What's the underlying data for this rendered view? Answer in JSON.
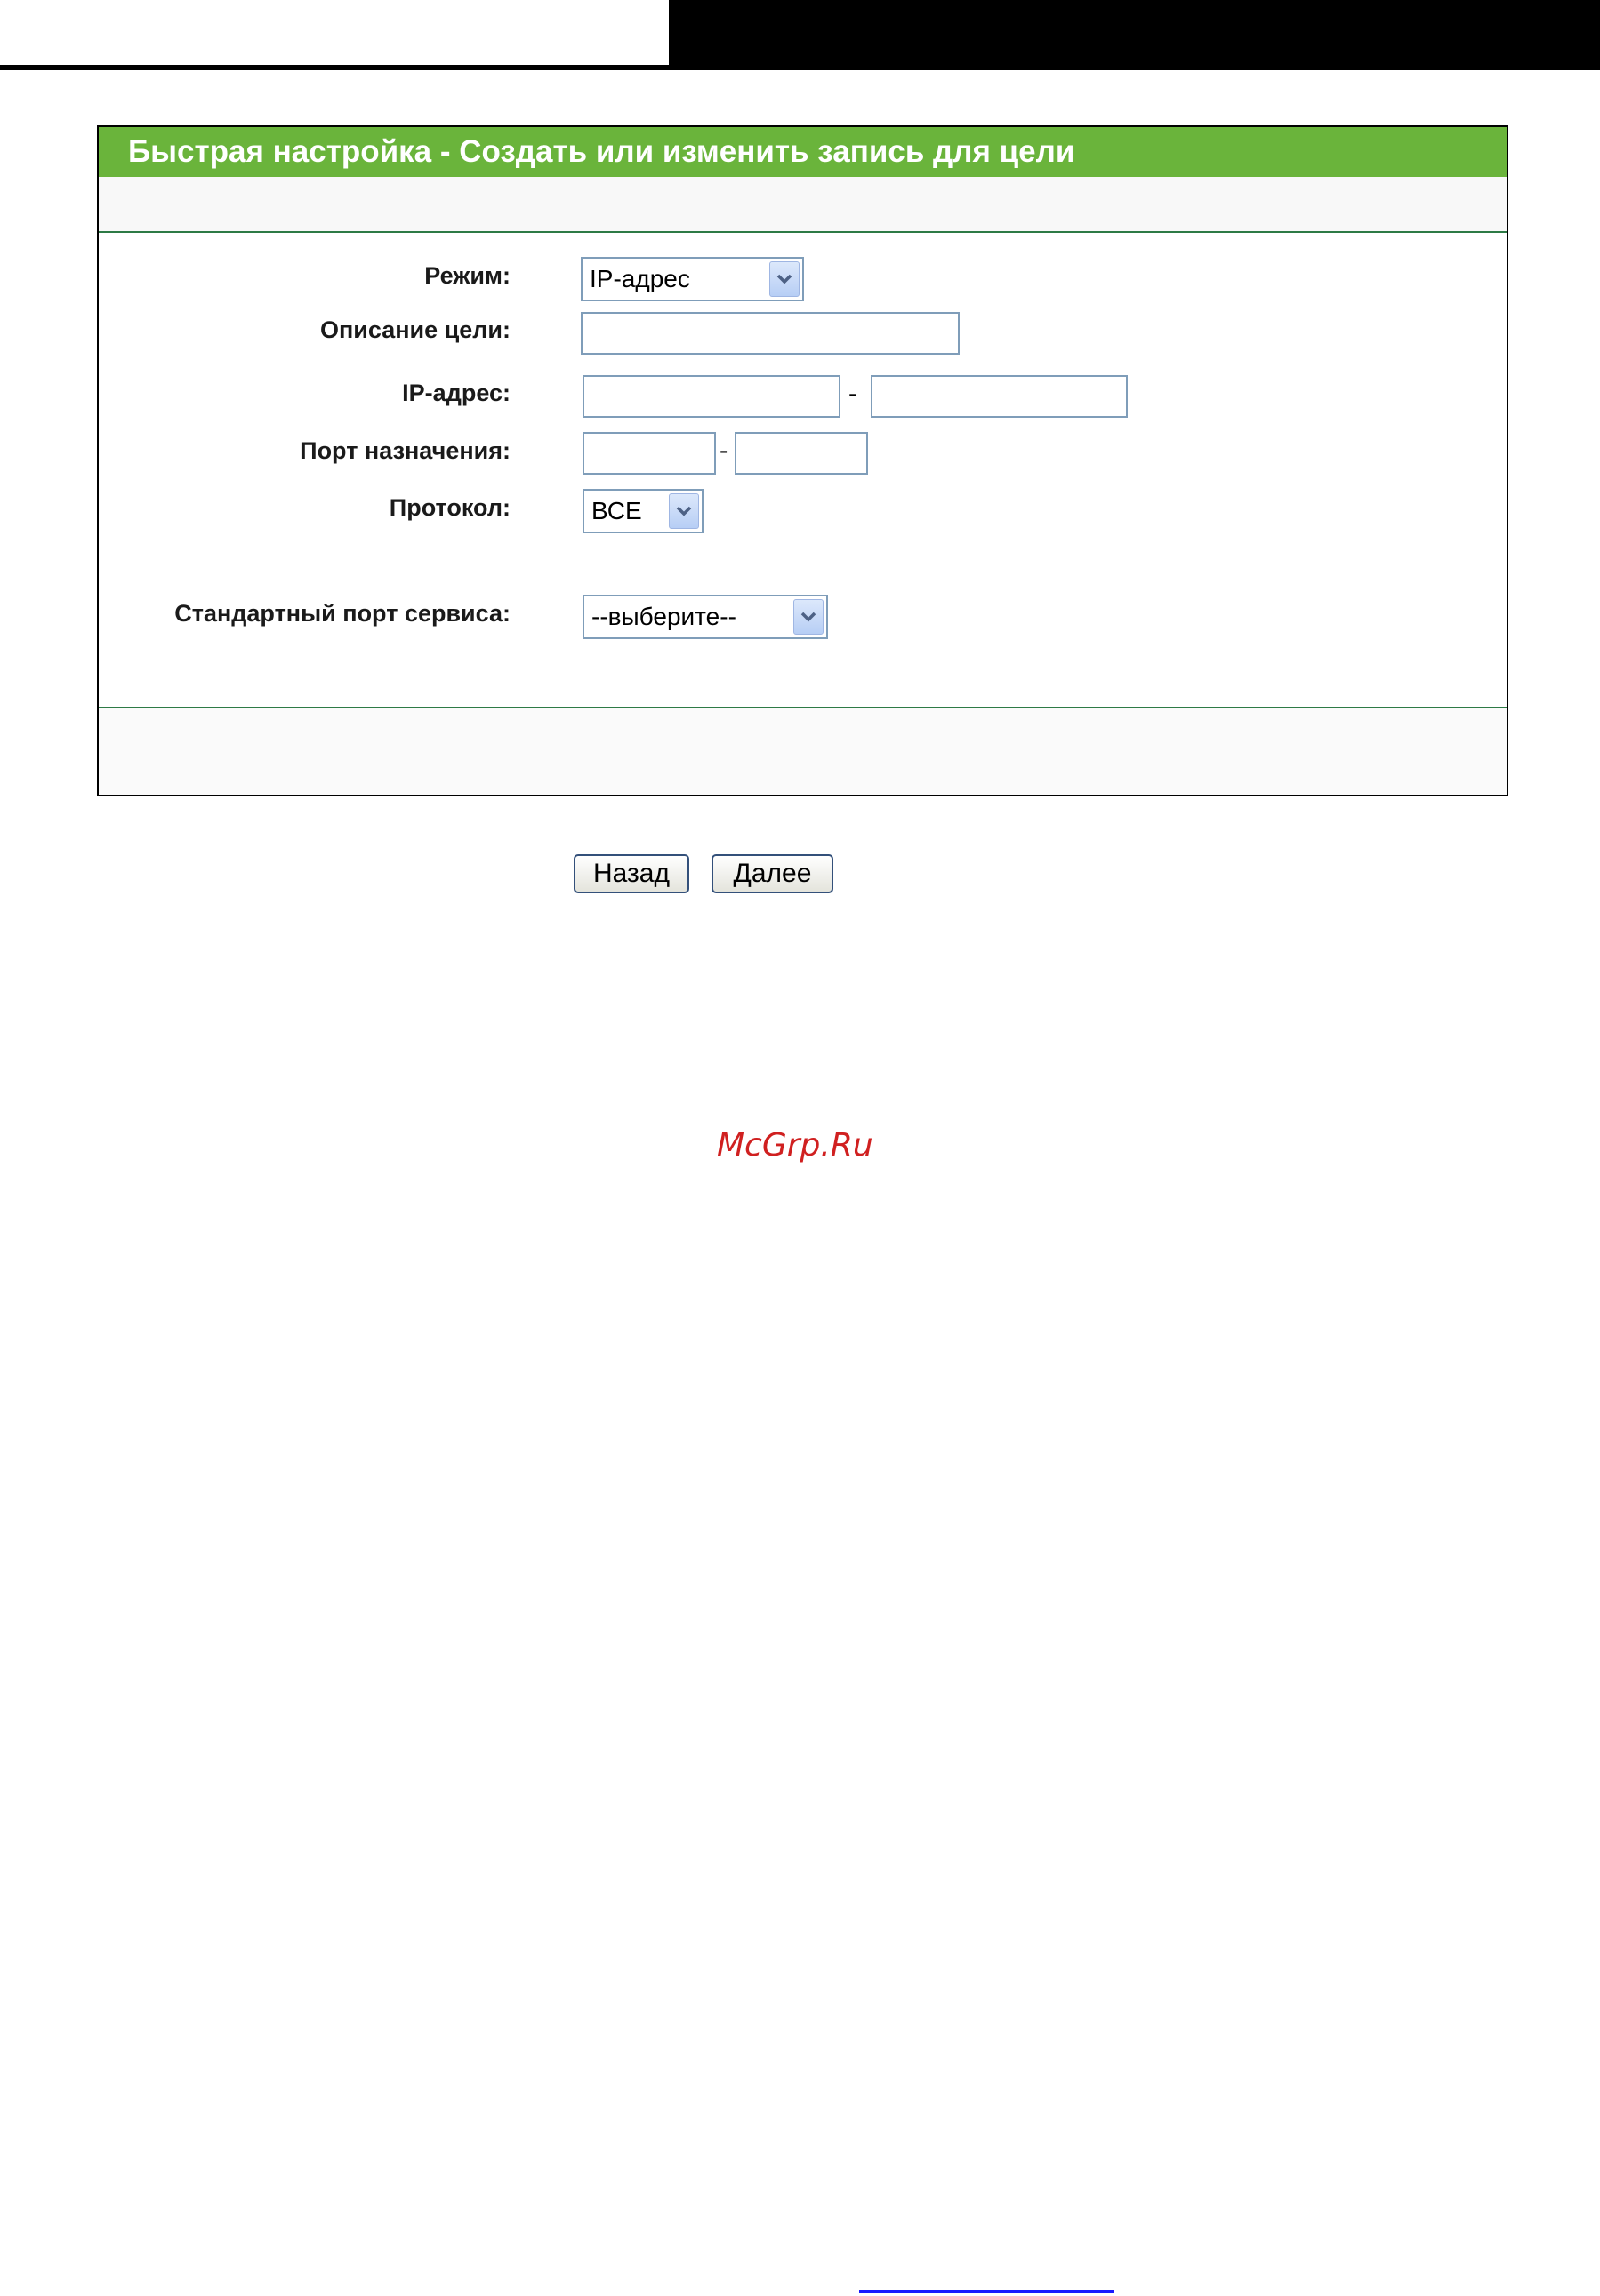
{
  "panel": {
    "title": "Быстрая настройка - Создать или изменить запись для цели"
  },
  "form": {
    "mode": {
      "label": "Режим:",
      "value": "IP-адрес"
    },
    "description": {
      "label": "Описание цели:",
      "value": ""
    },
    "ip": {
      "label": "IP-адрес:",
      "start_value": "",
      "end_value": "",
      "separator": "-"
    },
    "port": {
      "label": "Порт назначения:",
      "start_value": "",
      "end_value": "",
      "separator": "-"
    },
    "protocol": {
      "label": "Протокол:",
      "value": "ВСЕ"
    },
    "service_port": {
      "label": "Стандартный порт сервиса:",
      "value": "--выберите--"
    }
  },
  "buttons": {
    "back_label": "Назад",
    "next_label": "Далее"
  },
  "watermark": {
    "text": "McGrp.Ru"
  },
  "colors": {
    "header_green": "#6ab43b",
    "divider_green": "#2d7a45",
    "watermark_red": "#d02020"
  }
}
